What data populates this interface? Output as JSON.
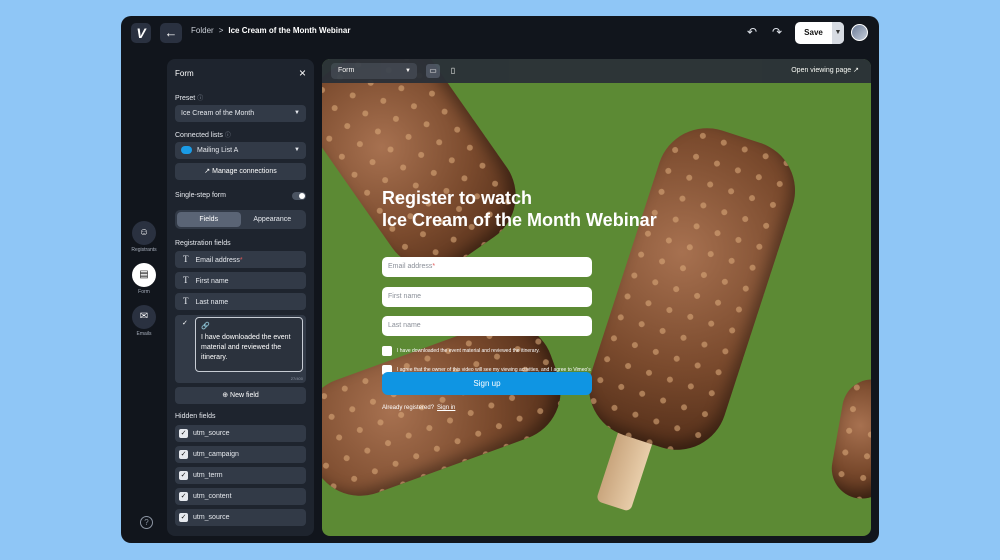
{
  "app": {
    "logo": "V"
  },
  "breadcrumb": {
    "parent": "Folder",
    "separator": ">",
    "current": "Ice Cream of the Month Webinar"
  },
  "toolbar": {
    "save_label": "Save"
  },
  "rail": {
    "registrants": "Registrants",
    "form": "Form",
    "emails": "Emails"
  },
  "panel": {
    "title": "Form",
    "preset_label": "Preset",
    "preset_value": "Ice Cream of the Month",
    "connected_label": "Connected lists",
    "connected_value": "Mailing List A",
    "manage_label": "Manage connections",
    "single_step_label": "Single-step form",
    "tabs": [
      "Fields",
      "Appearance"
    ],
    "registration_label": "Registration fields",
    "fields": [
      "Email address",
      "First name",
      "Last name"
    ],
    "consent_text": "I have downloaded the event material and reviewed the itinerary.",
    "consent_counter": "27/400",
    "new_field_label": "New field",
    "hidden_label": "Hidden fields",
    "hidden_fields": [
      "utm_source",
      "utm_campaign",
      "utm_term",
      "utm_content",
      "utm_source"
    ]
  },
  "preview": {
    "mode_select": "Form",
    "open_label": "Open viewing page",
    "headline_line1": "Register to watch",
    "headline_line2": "Ice Cream of the Month Webinar",
    "email_placeholder": "Email address",
    "first_placeholder": "First name",
    "last_placeholder": "Last name",
    "consent1": "I have downloaded the event material and reviewed the itinerary.",
    "consent2": "I agree that the owner of this video will see my viewing activities, and I agree to Vimeo's Terms of Service and Privacy Policy.",
    "signup_label": "Sign up",
    "already_text": "Already registered?",
    "signin_label": "Sign in"
  },
  "colors": {
    "accent": "#0f95e3",
    "background": "#8fc6f6",
    "preview_bg": "#5c8a34"
  }
}
